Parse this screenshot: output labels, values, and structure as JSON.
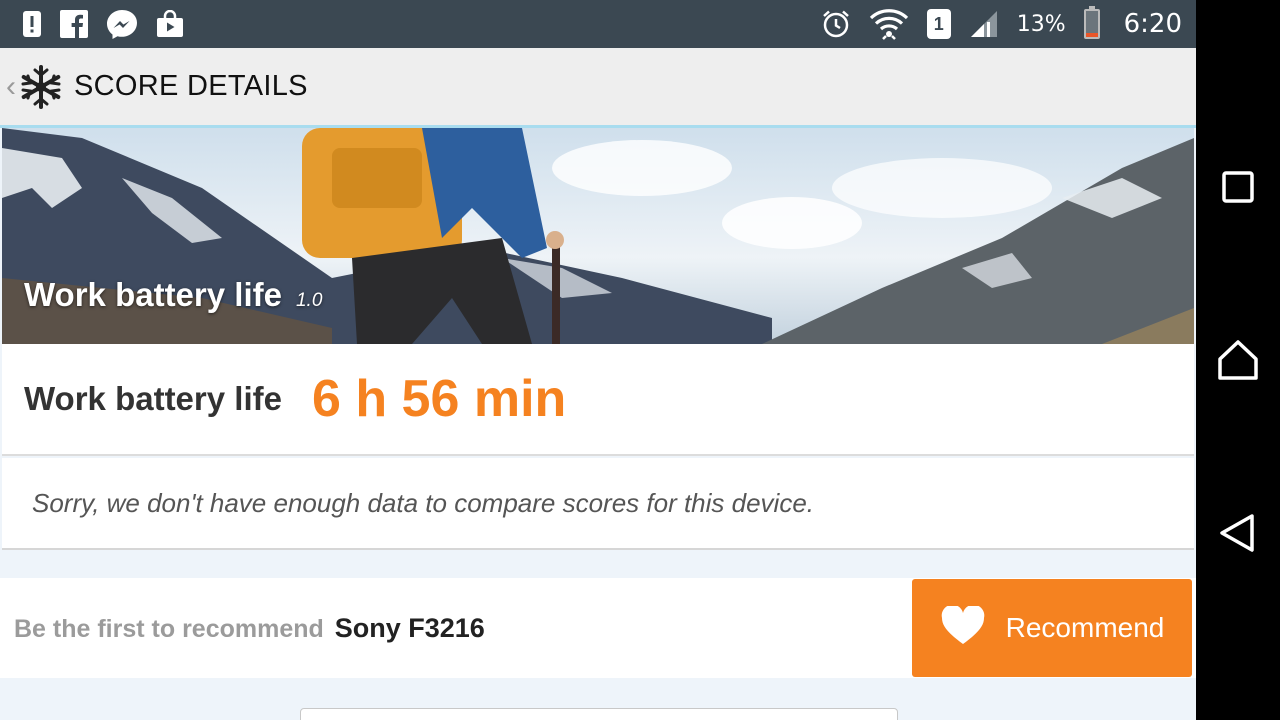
{
  "status_bar": {
    "left_icons": [
      "alert-icon",
      "facebook-icon",
      "messenger-icon",
      "shopping-bag-icon"
    ],
    "right_icons": [
      "alarm-icon",
      "wifi-icon",
      "sim-icon",
      "signal-icon",
      "battery-icon"
    ],
    "sim_number": "1",
    "battery_percent": "13%",
    "time": "6:20"
  },
  "app_bar": {
    "back_icon": "back-chevron-icon",
    "logo_icon": "snowflake-logo-icon",
    "title": "SCORE DETAILS"
  },
  "hero": {
    "title": "Work battery life",
    "version": "1.0"
  },
  "score": {
    "label": "Work battery life",
    "value": "6 h 56 min"
  },
  "compare": {
    "message": "Sorry, we don't have enough data to compare scores for this device."
  },
  "recommend": {
    "prefix": "Be the first to recommend",
    "device": "Sony F3216",
    "button_label": "Recommend",
    "button_icon": "heart-icon"
  },
  "nav_bar": {
    "buttons": [
      "recents-icon",
      "home-icon",
      "back-icon"
    ]
  },
  "colors": {
    "accent": "#f58220",
    "status_bar": "#3b4852",
    "app_bar": "#eeeeee"
  }
}
